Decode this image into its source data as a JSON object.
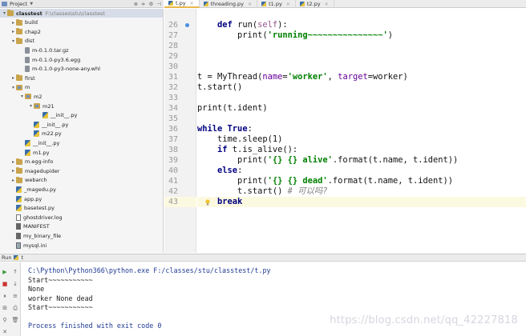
{
  "project_panel": {
    "title": "Project",
    "tree": [
      {
        "label": "classtest",
        "path": "F:\\classes\\stu\\classtest",
        "depth": 0,
        "kind": "folder",
        "arrow": "▾",
        "selected": true
      },
      {
        "label": "build",
        "depth": 1,
        "kind": "folder",
        "arrow": "▸"
      },
      {
        "label": "chap2",
        "depth": 1,
        "kind": "folder",
        "arrow": "▸"
      },
      {
        "label": "dist",
        "depth": 1,
        "kind": "folder",
        "arrow": "▾"
      },
      {
        "label": "m-0.1.0.tar.gz",
        "depth": 2,
        "kind": "arch",
        "arrow": ""
      },
      {
        "label": "m-0.1.0-py3.6.egg",
        "depth": 2,
        "kind": "arch",
        "arrow": ""
      },
      {
        "label": "m-0.1.0-py3-none-any.whl",
        "depth": 2,
        "kind": "arch",
        "arrow": ""
      },
      {
        "label": "first",
        "depth": 1,
        "kind": "folder",
        "arrow": "▸"
      },
      {
        "label": "m",
        "depth": 1,
        "kind": "pkg",
        "arrow": "▾"
      },
      {
        "label": "m2",
        "depth": 2,
        "kind": "pkg",
        "arrow": "▾"
      },
      {
        "label": "m21",
        "depth": 3,
        "kind": "pkg",
        "arrow": "▾"
      },
      {
        "label": "__init__.py",
        "depth": 4,
        "kind": "py",
        "arrow": ""
      },
      {
        "label": "__init__.py",
        "depth": 3,
        "kind": "py",
        "arrow": ""
      },
      {
        "label": "m22.py",
        "depth": 3,
        "kind": "py",
        "arrow": ""
      },
      {
        "label": "__init__.py",
        "depth": 2,
        "kind": "py",
        "arrow": ""
      },
      {
        "label": "m1.py",
        "depth": 2,
        "kind": "py",
        "arrow": ""
      },
      {
        "label": "m.egg-info",
        "depth": 1,
        "kind": "folder",
        "arrow": "▸"
      },
      {
        "label": "magedupider",
        "depth": 1,
        "kind": "folder",
        "arrow": "▸"
      },
      {
        "label": "webarch",
        "depth": 1,
        "kind": "folder",
        "arrow": "▸"
      },
      {
        "label": "_magedu.py",
        "depth": 1,
        "kind": "py",
        "arrow": ""
      },
      {
        "label": "app.py",
        "depth": 1,
        "kind": "py",
        "arrow": ""
      },
      {
        "label": "basetest.py",
        "depth": 1,
        "kind": "py",
        "arrow": ""
      },
      {
        "label": "ghostdriver.log",
        "depth": 1,
        "kind": "txt",
        "arrow": ""
      },
      {
        "label": "MANIFEST",
        "depth": 1,
        "kind": "file",
        "arrow": ""
      },
      {
        "label": "my_binary_file",
        "depth": 1,
        "kind": "file",
        "arrow": ""
      },
      {
        "label": "mysql.ini",
        "depth": 1,
        "kind": "ini",
        "arrow": ""
      }
    ]
  },
  "tabs": [
    {
      "label": "t.py",
      "active": true
    },
    {
      "label": "threading.py",
      "active": false
    },
    {
      "label": "t1.py",
      "active": false
    },
    {
      "label": "t2.py",
      "active": false
    }
  ],
  "editor": {
    "lines": [
      {
        "num": "26",
        "text": "    def run(self):"
      },
      {
        "num": "27",
        "text": "        print('running~~~~~~~~~~~~~~~')"
      },
      {
        "num": "28",
        "text": ""
      },
      {
        "num": "29",
        "text": ""
      },
      {
        "num": "30",
        "text": ""
      },
      {
        "num": "31",
        "text": "t = MyThread(name='worker', target=worker)"
      },
      {
        "num": "32",
        "text": "t.start()"
      },
      {
        "num": "33",
        "text": ""
      },
      {
        "num": "34",
        "text": "print(t.ident)"
      },
      {
        "num": "35",
        "text": ""
      },
      {
        "num": "36",
        "text": "while True:"
      },
      {
        "num": "37",
        "text": "    time.sleep(1)"
      },
      {
        "num": "38",
        "text": "    if t.is_alive():"
      },
      {
        "num": "39",
        "text": "        print('{} {} alive'.format(t.name, t.ident))"
      },
      {
        "num": "40",
        "text": "    else:"
      },
      {
        "num": "41",
        "text": "        print('{} {} dead'.format(t.name, t.ident))"
      },
      {
        "num": "42",
        "text": "        t.start() # 可以吗?"
      },
      {
        "num": "43",
        "text": "    break"
      }
    ],
    "current_line": "43"
  },
  "run_panel": {
    "title": "Run",
    "tab_label": "t",
    "output": [
      "C:\\Python\\Python366\\python.exe F:/classes/stu/classtest/t.py",
      "Start~~~~~~~~~~~",
      "None",
      "worker None dead",
      "Start~~~~~~~~~~~",
      "",
      "Process finished with exit code 0"
    ]
  },
  "watermark": "https://blog.csdn.net/qq_42227818"
}
